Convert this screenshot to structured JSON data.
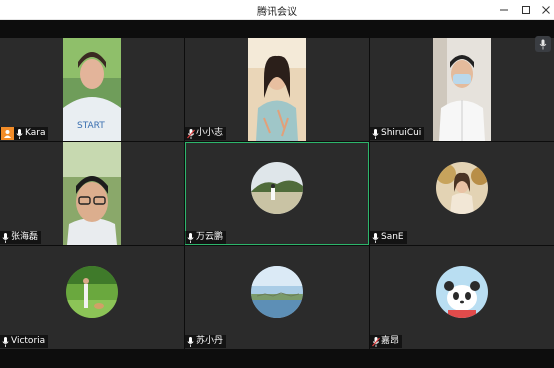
{
  "window": {
    "title": "腾讯会议",
    "controls": [
      "minimize-icon",
      "maximize-icon",
      "close-icon"
    ]
  },
  "participants": [
    {
      "name": "Kara",
      "host": true,
      "muted": false,
      "view": "video"
    },
    {
      "name": "小小志",
      "host": false,
      "muted": true,
      "view": "video"
    },
    {
      "name": "ShiruiCui",
      "host": false,
      "muted": false,
      "view": "video"
    },
    {
      "name": "张海磊",
      "host": false,
      "muted": false,
      "view": "video"
    },
    {
      "name": "万云鹏",
      "host": false,
      "muted": false,
      "view": "avatar",
      "active_speaker": true
    },
    {
      "name": "SanE",
      "host": false,
      "muted": false,
      "view": "avatar"
    },
    {
      "name": "Victoria",
      "host": false,
      "muted": false,
      "view": "avatar"
    },
    {
      "name": "苏小丹",
      "host": false,
      "muted": false,
      "view": "avatar"
    },
    {
      "name": "嘉昂",
      "host": false,
      "muted": true,
      "view": "avatar"
    }
  ],
  "colors": {
    "tile_bg": "#2b2b2b",
    "window_bg": "#0d0d0d",
    "active_border": "#2db56b",
    "host_badge": "#f28c28",
    "muted_mic": "#e04040"
  }
}
